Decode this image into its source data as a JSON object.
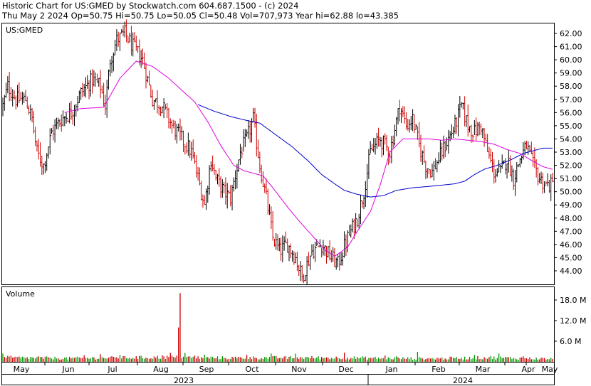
{
  "header": {
    "line1": "Historic Chart for US:GMED by Stockwatch.com 604.687.1500 - (c) 2024",
    "line2": "Thu May  2 2024   Op=50.75   Hi=50.75   Lo=50.05   Cl=50.48   Vol=707,973   Year hi=62.88   lo=43.385"
  },
  "chart_data": [
    {
      "type": "ohlc",
      "title": "US:GMED",
      "ylim": [
        43.0,
        63.0
      ],
      "yticks": [
        62,
        61,
        60,
        59,
        58,
        57,
        56,
        55,
        54,
        53,
        52,
        51,
        50,
        49,
        48,
        47,
        46,
        45,
        44
      ],
      "ytick_labels": [
        "62.00",
        "61.00",
        "60.00",
        "59.00",
        "58.00",
        "57.00",
        "56.00",
        "55.00",
        "54.00",
        "53.00",
        "52.00",
        "51.00",
        "50.00",
        "49.00",
        "48.00",
        "47.00",
        "46.00",
        "45.00",
        "44.00"
      ],
      "x_months": [
        "May",
        "Jun",
        "Jul",
        "Aug",
        "Sep",
        "Oct",
        "Nov",
        "Dec",
        "Jan",
        "Feb",
        "Mar",
        "Apr",
        "May"
      ],
      "x_years": [
        "2023",
        "2024"
      ],
      "grid": false,
      "price_anchors": [
        [
          0,
          56.5
        ],
        [
          3,
          58.0
        ],
        [
          8,
          57.0
        ],
        [
          14,
          57.0
        ],
        [
          18,
          55.5
        ],
        [
          21,
          53.0
        ],
        [
          25,
          52.0
        ],
        [
          30,
          54.5
        ],
        [
          36,
          55.5
        ],
        [
          42,
          56.0
        ],
        [
          48,
          57.5
        ],
        [
          55,
          58.5
        ],
        [
          60,
          58.0
        ],
        [
          63,
          56.5
        ],
        [
          66,
          60.0
        ],
        [
          70,
          61.5
        ],
        [
          75,
          62.0
        ],
        [
          80,
          61.0
        ],
        [
          86,
          60.0
        ],
        [
          92,
          57.0
        ],
        [
          98,
          56.5
        ],
        [
          104,
          55.0
        ],
        [
          110,
          54.0
        ],
        [
          116,
          53.0
        ],
        [
          120,
          51.0
        ],
        [
          124,
          49.0
        ],
        [
          128,
          52.5
        ],
        [
          131,
          51.0
        ],
        [
          136,
          50.0
        ],
        [
          140,
          49.5
        ],
        [
          146,
          53.0
        ],
        [
          150,
          54.0
        ],
        [
          154,
          55.5
        ],
        [
          158,
          52.0
        ],
        [
          162,
          49.5
        ],
        [
          166,
          46.5
        ],
        [
          170,
          45.5
        ],
        [
          175,
          46.0
        ],
        [
          180,
          45.0
        ],
        [
          184,
          43.5
        ],
        [
          190,
          45.5
        ],
        [
          196,
          46.0
        ],
        [
          202,
          45.0
        ],
        [
          206,
          44.5
        ],
        [
          212,
          46.5
        ],
        [
          218,
          48.0
        ],
        [
          222,
          50.0
        ],
        [
          226,
          53.0
        ],
        [
          232,
          54.0
        ],
        [
          238,
          53.0
        ],
        [
          244,
          56.5
        ],
        [
          248,
          55.0
        ],
        [
          252,
          55.5
        ],
        [
          256,
          53.5
        ],
        [
          260,
          52.0
        ],
        [
          264,
          51.5
        ],
        [
          268,
          52.5
        ],
        [
          272,
          53.5
        ],
        [
          278,
          55.0
        ],
        [
          282,
          56.5
        ],
        [
          286,
          55.0
        ],
        [
          290,
          54.5
        ],
        [
          294,
          55.0
        ],
        [
          298,
          53.0
        ],
        [
          302,
          51.5
        ],
        [
          306,
          51.5
        ],
        [
          310,
          52.5
        ],
        [
          314,
          51.0
        ],
        [
          318,
          52.5
        ],
        [
          322,
          53.5
        ],
        [
          326,
          52.0
        ],
        [
          330,
          51.0
        ],
        [
          334,
          50.5
        ],
        [
          338,
          50.5
        ]
      ],
      "ma_fast_anchors": [
        [
          38,
          56.0
        ],
        [
          48,
          56.3
        ],
        [
          62,
          56.4
        ],
        [
          72,
          58.6
        ],
        [
          82,
          59.9
        ],
        [
          92,
          59.5
        ],
        [
          102,
          58.6
        ],
        [
          110,
          57.7
        ],
        [
          118,
          56.8
        ],
        [
          126,
          55.3
        ],
        [
          134,
          53.5
        ],
        [
          142,
          52.0
        ],
        [
          148,
          51.6
        ],
        [
          154,
          51.4
        ],
        [
          160,
          51.2
        ],
        [
          166,
          50.3
        ],
        [
          174,
          49.0
        ],
        [
          182,
          47.8
        ],
        [
          190,
          46.7
        ],
        [
          198,
          45.6
        ],
        [
          204,
          45.1
        ],
        [
          212,
          45.8
        ],
        [
          218,
          47.0
        ],
        [
          226,
          48.5
        ],
        [
          232,
          50.5
        ],
        [
          238,
          53.0
        ],
        [
          246,
          54.0
        ],
        [
          254,
          54.0
        ],
        [
          262,
          54.0
        ],
        [
          270,
          53.9
        ],
        [
          278,
          54.0
        ],
        [
          286,
          53.9
        ],
        [
          294,
          53.8
        ],
        [
          302,
          53.6
        ],
        [
          310,
          53.2
        ],
        [
          318,
          52.9
        ],
        [
          326,
          52.3
        ],
        [
          332,
          51.9
        ],
        [
          338,
          51.7
        ]
      ],
      "ma_slow_anchors": [
        [
          120,
          56.6
        ],
        [
          130,
          56.1
        ],
        [
          140,
          55.7
        ],
        [
          150,
          55.4
        ],
        [
          158,
          55.2
        ],
        [
          168,
          54.3
        ],
        [
          178,
          53.4
        ],
        [
          188,
          52.3
        ],
        [
          196,
          51.3
        ],
        [
          204,
          50.6
        ],
        [
          210,
          50.1
        ],
        [
          218,
          49.8
        ],
        [
          226,
          49.6
        ],
        [
          234,
          49.7
        ],
        [
          242,
          50.1
        ],
        [
          252,
          50.3
        ],
        [
          262,
          50.4
        ],
        [
          270,
          50.5
        ],
        [
          278,
          50.6
        ],
        [
          284,
          50.8
        ],
        [
          290,
          51.3
        ],
        [
          296,
          51.7
        ],
        [
          304,
          52.0
        ],
        [
          312,
          52.4
        ],
        [
          320,
          52.9
        ],
        [
          326,
          53.1
        ],
        [
          332,
          53.3
        ],
        [
          338,
          53.3
        ]
      ]
    },
    {
      "type": "bar",
      "title": "Volume",
      "ylim": [
        0,
        22.0
      ],
      "yticks": [
        6.0,
        12.0,
        18.0
      ],
      "ytick_labels": [
        "6.0 M",
        "12.0 M",
        "18.0 M"
      ],
      "baseline_anchors": [
        [
          0,
          1.3
        ],
        [
          40,
          1.1
        ],
        [
          80,
          1.3
        ],
        [
          100,
          1.4
        ],
        [
          140,
          1.2
        ],
        [
          180,
          1.3
        ],
        [
          220,
          1.2
        ],
        [
          260,
          1.0
        ],
        [
          300,
          1.3
        ],
        [
          338,
          0.9
        ]
      ],
      "spikes": [
        [
          0,
          2.4
        ],
        [
          5,
          1.8
        ],
        [
          22,
          1.6
        ],
        [
          50,
          1.9
        ],
        [
          60,
          2.2
        ],
        [
          72,
          2.0
        ],
        [
          98,
          1.9
        ],
        [
          103,
          2.6
        ],
        [
          108,
          10.0
        ],
        [
          109,
          20.0
        ],
        [
          112,
          2.6
        ],
        [
          118,
          1.8
        ],
        [
          124,
          2.1
        ],
        [
          150,
          2.0
        ],
        [
          165,
          2.4
        ],
        [
          180,
          2.4
        ],
        [
          210,
          2.7
        ],
        [
          235,
          1.8
        ],
        [
          242,
          1.6
        ],
        [
          255,
          2.9
        ],
        [
          290,
          2.0
        ],
        [
          305,
          2.4
        ],
        [
          320,
          1.6
        ]
      ]
    }
  ]
}
